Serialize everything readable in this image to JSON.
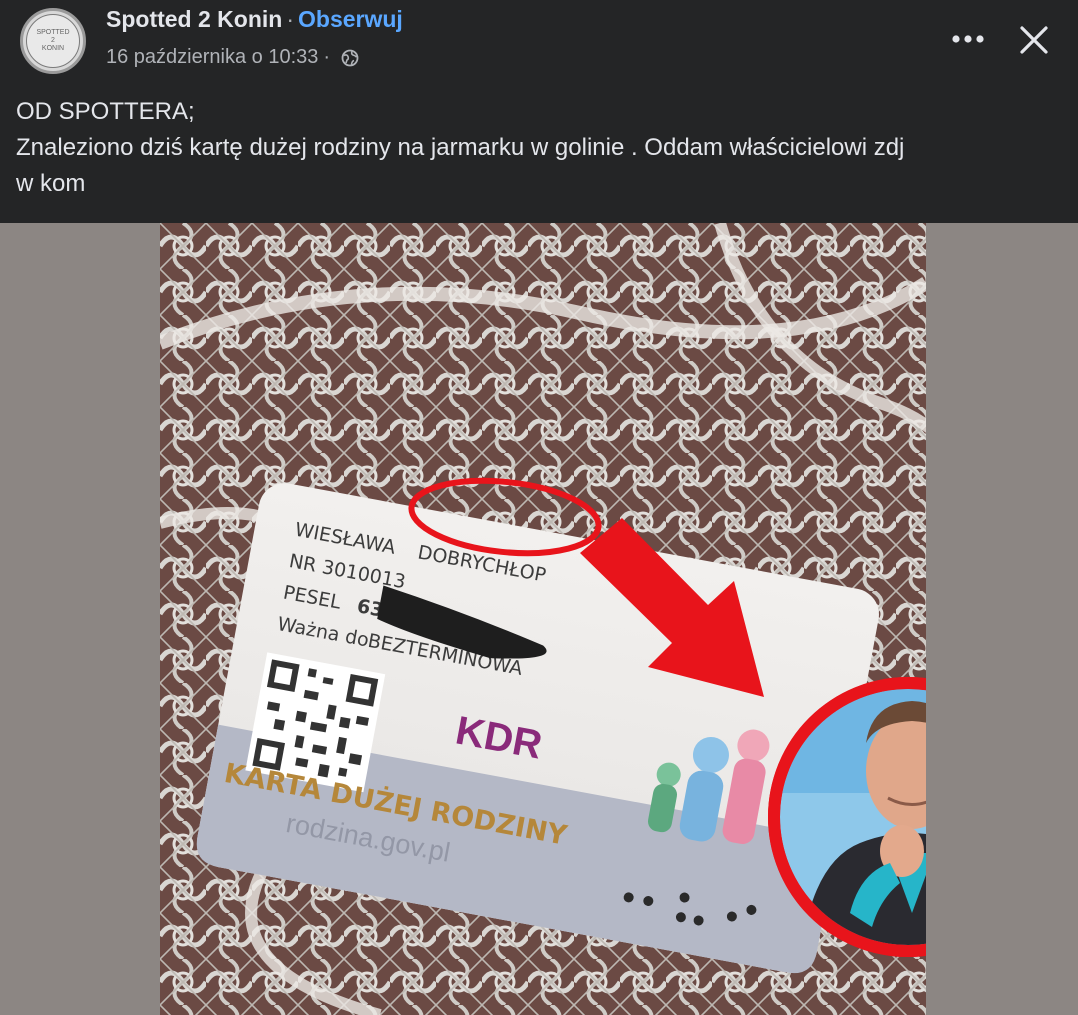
{
  "header": {
    "page_name": "Spotted 2 Konin",
    "separator": "·",
    "follow_label": "Obserwuj",
    "timestamp": "16 października o 10:33",
    "meta_separator": "·",
    "avatar_text": [
      "SPOTTED",
      "2",
      "KONIN"
    ]
  },
  "post": {
    "lines": [
      "OD SPOTTERA;",
      "Znaleziono dziś kartę dużej rodziny na jarmarku w golinie . Oddam właścicielowi  zdj",
      "w kom"
    ]
  },
  "photo": {
    "card": {
      "name_line": "WIESŁAWA",
      "surname_line": "DOBRYCHŁOP",
      "nr_line": "NR 3010013",
      "pesel_label": "PESEL",
      "pesel_value": "63101",
      "valid_label": "Ważna do",
      "valid_value": "BEZTERMINOWA",
      "badge": "KDR",
      "title": "KARTA DUŻEJ RODZINY",
      "url": "rodzina.gov.pl"
    }
  },
  "colors": {
    "background": "#242526",
    "text": "#e4e6eb",
    "secondary_text": "#b0b3b8",
    "link": "#5aa7ff",
    "highlight_red": "#e8141b",
    "card_purple": "#8a2a7a",
    "card_gold": "#b5873a"
  },
  "icons": {
    "globe": "globe-icon",
    "more": "more-horizontal-icon",
    "close": "close-icon"
  }
}
